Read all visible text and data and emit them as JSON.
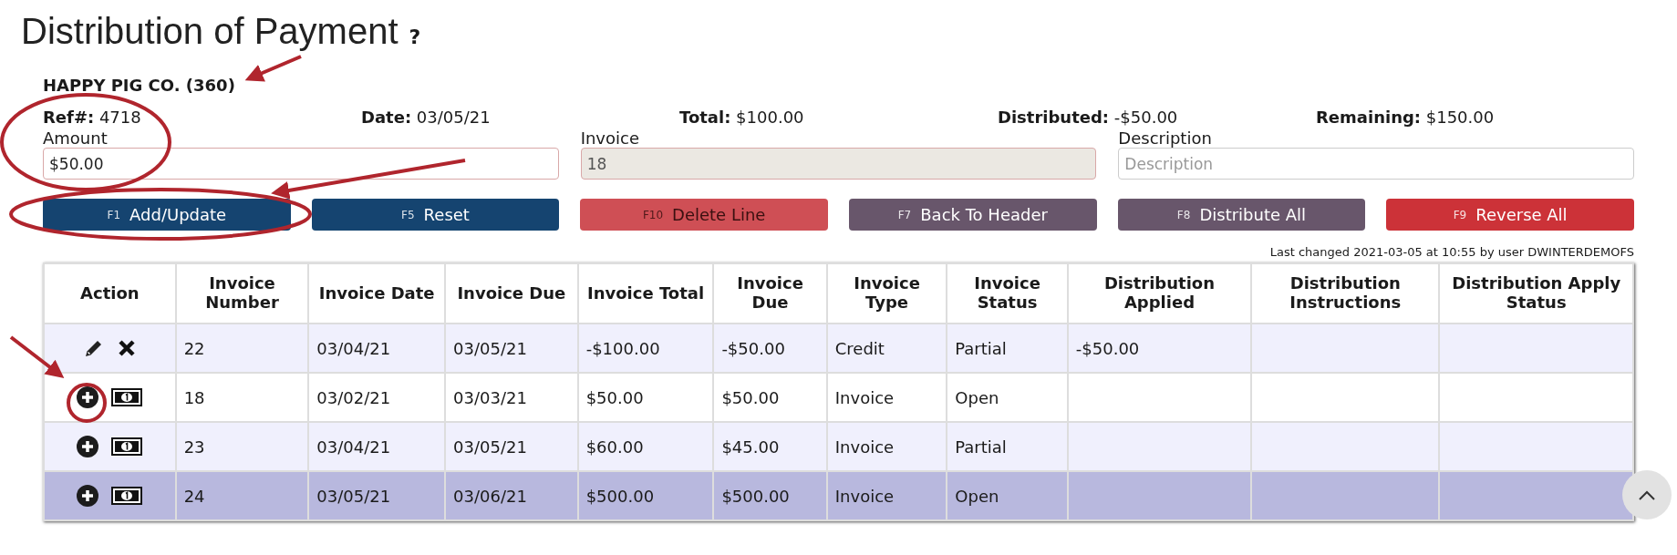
{
  "title": "Distribution of Payment",
  "help": "?",
  "company": "HAPPY PIG CO. (360)",
  "summary": [
    {
      "label": "Ref#:",
      "value": "4718"
    },
    {
      "label": "Date:",
      "value": "03/05/21"
    },
    {
      "label": "Total:",
      "value": "$100.00"
    },
    {
      "label": "Distributed:",
      "value": "-$50.00"
    },
    {
      "label": "Remaining:",
      "value": "$150.00"
    }
  ],
  "fields": [
    {
      "label": "Amount",
      "value": "$50.00",
      "disabled": false
    },
    {
      "label": "Invoice",
      "value": "18",
      "disabled": true
    },
    {
      "label": "Description",
      "placeholder": "Description",
      "disabled": false
    }
  ],
  "buttons": [
    {
      "hotkey": "F1",
      "label": "Add/Update",
      "kind": "primary"
    },
    {
      "hotkey": "F5",
      "label": "Reset",
      "kind": "primary"
    },
    {
      "hotkey": "F10",
      "label": "Delete Line",
      "kind": "warning"
    },
    {
      "hotkey": "F7",
      "label": "Back To Header",
      "kind": "muted"
    },
    {
      "hotkey": "F8",
      "label": "Distribute All",
      "kind": "muted"
    },
    {
      "hotkey": "F9",
      "label": "Reverse All",
      "kind": "danger"
    }
  ],
  "last_changed": "Last changed 2021-03-05 at 10:55 by user DWINTERDEMOFS",
  "table": {
    "columns": [
      "Action",
      "Invoice Number",
      "Invoice Date",
      "Invoice Due",
      "Invoice Total",
      "Invoice Due",
      "Invoice Type",
      "Invoice Status",
      "Distribution Applied",
      "Distribution Instructions",
      "Distribution Apply Status"
    ],
    "rows": [
      {
        "kind": "edit",
        "selected": false,
        "cells": [
          "",
          "22",
          "03/04/21",
          "03/05/21",
          "-$100.00",
          "-$50.00",
          "Credit",
          "Partial",
          "-$50.00",
          "",
          ""
        ]
      },
      {
        "kind": "add",
        "selected": false,
        "cells": [
          "",
          "18",
          "03/02/21",
          "03/03/21",
          "$50.00",
          "$50.00",
          "Invoice",
          "Open",
          "",
          "",
          ""
        ]
      },
      {
        "kind": "add",
        "selected": false,
        "cells": [
          "",
          "23",
          "03/04/21",
          "03/05/21",
          "$60.00",
          "$45.00",
          "Invoice",
          "Partial",
          "",
          "",
          ""
        ]
      },
      {
        "kind": "add",
        "selected": true,
        "cells": [
          "",
          "24",
          "03/05/21",
          "03/06/21",
          "$500.00",
          "$500.00",
          "Invoice",
          "Open",
          "",
          "",
          ""
        ]
      }
    ]
  }
}
